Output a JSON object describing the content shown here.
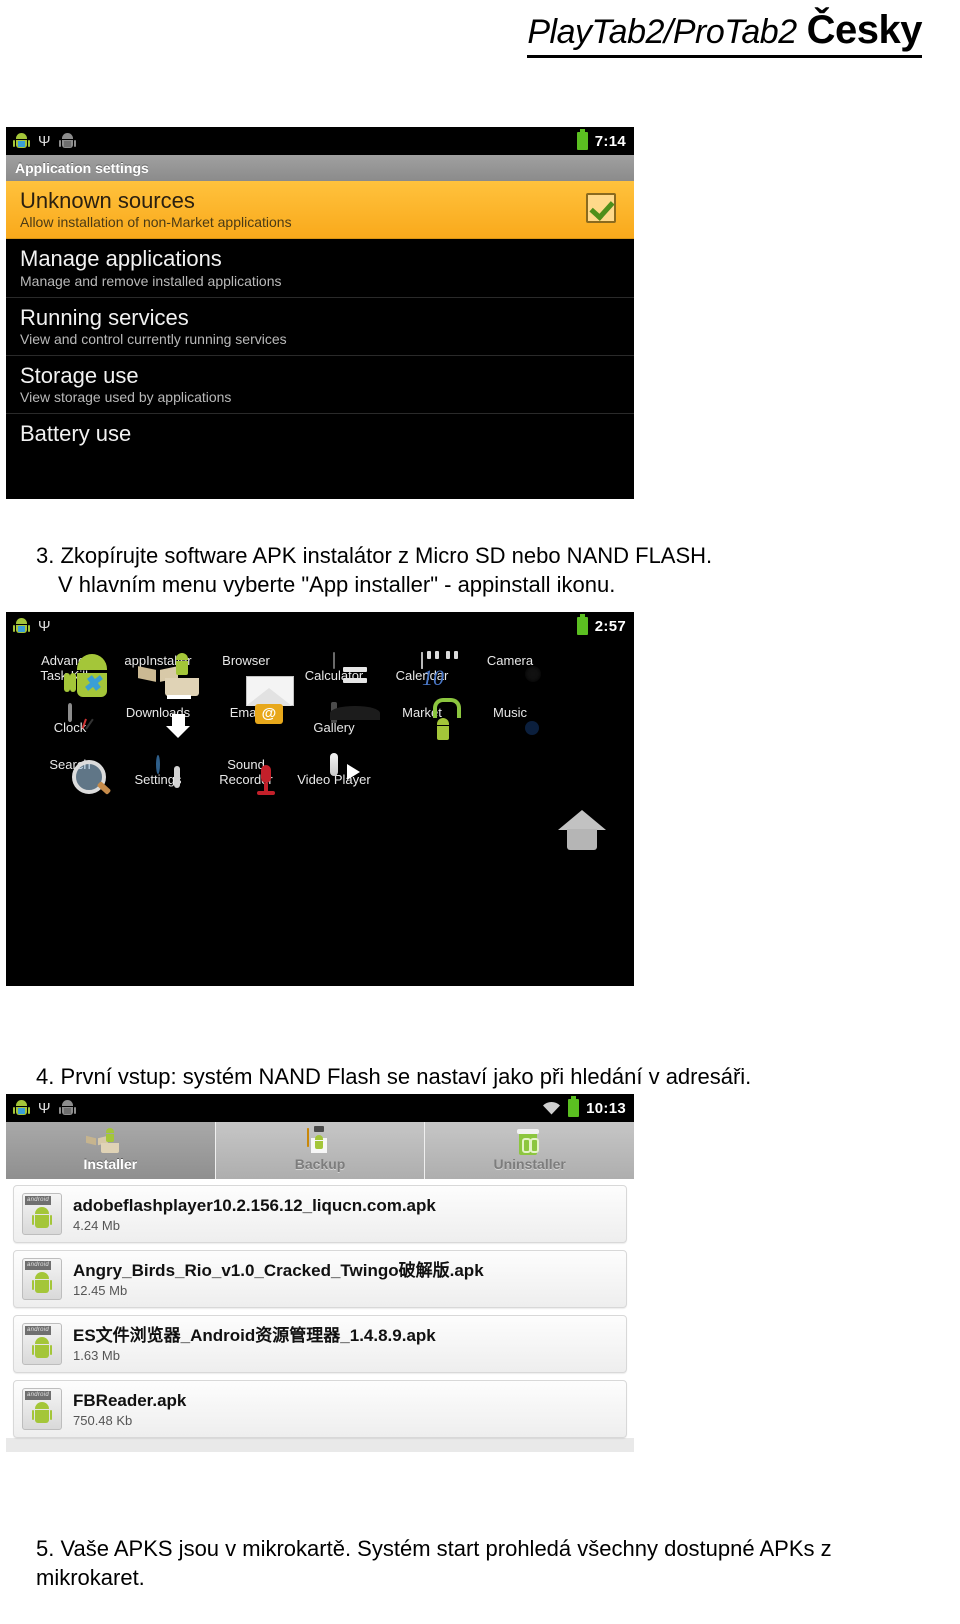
{
  "document": {
    "header": {
      "title_italic": "PlayTab2/ProTab2",
      "title_bold": "Česky"
    },
    "steps": {
      "step3_line1": "3. Zkopírujte software APK instalátor z Micro SD nebo NAND FLASH.",
      "step3_line2": "V hlavním menu vyberte \"App installer\" - appinstall ikonu.",
      "step4_line1": "4. První vstup: systém NAND Flash  se nastaví jako při hledání v adresáři.",
      "step5_line1": "5. Vaše APKS jsou v mikrokartě. Systém start prohledá všechny dostupné APKs z",
      "step5_line2": "mikrokaret."
    }
  },
  "settings_screenshot": {
    "statusbar": {
      "time": "7:14",
      "icons": [
        "android-robot-icon",
        "usb-icon",
        "android-debug-icon",
        "battery-icon"
      ]
    },
    "titlebar": "Application settings",
    "rows": [
      {
        "title": "Unknown sources",
        "subtitle": "Allow installation of non-Market applications",
        "checked": true
      },
      {
        "title": "Manage applications",
        "subtitle": "Manage and remove installed applications",
        "checked": false
      },
      {
        "title": "Running services",
        "subtitle": "View and control currently running services",
        "checked": false
      },
      {
        "title": "Storage use",
        "subtitle": "View storage used by applications",
        "checked": false
      },
      {
        "title": "Battery use",
        "subtitle": "",
        "checked": false
      }
    ],
    "highlight_color": "#f9a91b"
  },
  "drawer_screenshot": {
    "statusbar": {
      "time": "2:57",
      "icons": [
        "android-robot-icon",
        "usb-icon",
        "battery-icon"
      ]
    },
    "apps_row1": [
      {
        "label": "Advanced\nTask Killer",
        "icon": "advanced-task-killer-icon"
      },
      {
        "label": "appInstaller",
        "icon": "app-installer-icon"
      },
      {
        "label": "Browser",
        "icon": "browser-icon"
      },
      {
        "label": "Calculator",
        "icon": "calculator-icon"
      },
      {
        "label": "Calendar",
        "icon": "calendar-icon"
      },
      {
        "label": "Camera",
        "icon": "camera-icon"
      }
    ],
    "apps_row2": [
      {
        "label": "Clock",
        "icon": "clock-icon"
      },
      {
        "label": "Downloads",
        "icon": "downloads-icon"
      },
      {
        "label": "Email",
        "icon": "email-icon"
      },
      {
        "label": "Gallery",
        "icon": "gallery-icon"
      },
      {
        "label": "Market",
        "icon": "market-icon"
      },
      {
        "label": "Music",
        "icon": "music-icon"
      }
    ],
    "apps_row3": [
      {
        "label": "Search",
        "icon": "search-icon"
      },
      {
        "label": "Settings",
        "icon": "settings-icon"
      },
      {
        "label": "Sound\nRecorder",
        "icon": "sound-recorder-icon"
      },
      {
        "label": "Video Player",
        "icon": "video-player-icon"
      }
    ],
    "home_button": "home-icon"
  },
  "installer_screenshot": {
    "statusbar": {
      "time": "10:13",
      "icons": [
        "android-robot-icon",
        "usb-icon",
        "android-debug-icon",
        "wifi-icon",
        "battery-icon"
      ]
    },
    "tabs": [
      {
        "label": "Installer",
        "icon": "installer-box-icon",
        "active": true
      },
      {
        "label": "Backup",
        "icon": "backup-clipboard-icon",
        "active": false
      },
      {
        "label": "Uninstaller",
        "icon": "uninstaller-trash-icon",
        "active": false
      }
    ],
    "apk_list": [
      {
        "name": "adobeflashplayer10.2.156.12_liqucn.com.apk",
        "size": "4.24 Mb",
        "badge": "android"
      },
      {
        "name": "Angry_Birds_Rio_v1.0_Cracked_Twingo破解版.apk",
        "size": "12.45 Mb",
        "badge": "android"
      },
      {
        "name": "ES文件浏览器_Android资源管理器_1.4.8.9.apk",
        "size": "1.63 Mb",
        "badge": "android"
      },
      {
        "name": "FBReader.apk",
        "size": "750.48 Kb",
        "badge": "android"
      }
    ]
  }
}
